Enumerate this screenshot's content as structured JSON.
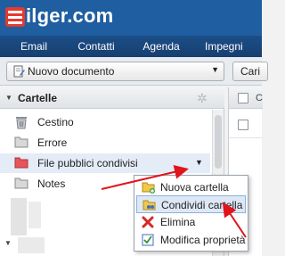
{
  "app": {
    "logo": "ilger.com",
    "brand_color": "#1f5ea0",
    "logo_badge_color": "#e53930"
  },
  "nav": {
    "tabs": [
      {
        "label": "Email"
      },
      {
        "label": "Contatti"
      },
      {
        "label": "Agenda"
      },
      {
        "label": "Impegni"
      }
    ]
  },
  "toolbar": {
    "new_document_label": "Nuovo documento",
    "new_document_icon": "document-edit-icon",
    "right_button_label": "Cari"
  },
  "folders_panel": {
    "title": "Cartelle",
    "settings_icon": "gear-icon",
    "items": [
      {
        "label": "Cestino",
        "icon": "trash-icon"
      },
      {
        "label": "Errore",
        "icon": "folder-icon"
      },
      {
        "label": "File pubblici condivisi",
        "icon": "shared-folder-icon",
        "selected": true,
        "folder_color": "#e8545a"
      },
      {
        "label": "Notes",
        "icon": "folder-icon"
      }
    ]
  },
  "context_menu": {
    "items": [
      {
        "label": "Nuova cartella",
        "icon": "new-folder-icon"
      },
      {
        "label": "Condividi cartella",
        "icon": "share-folder-icon",
        "highlighted": true
      },
      {
        "label": "Elimina",
        "icon": "delete-x-icon"
      },
      {
        "label": "Modifica proprietà",
        "icon": "edit-properties-icon"
      }
    ]
  },
  "annotation_arrow_color": "#e0141c",
  "right_table": {
    "column_header_fragment": "C"
  }
}
